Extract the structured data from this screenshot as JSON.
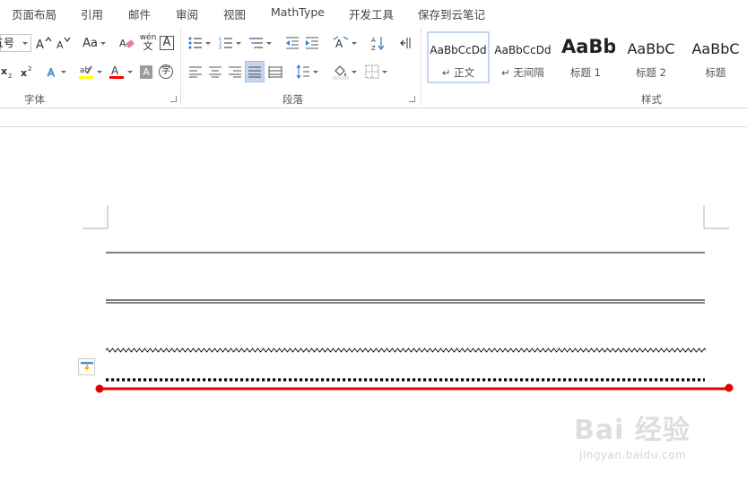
{
  "menu": {
    "tabs": [
      "页面布局",
      "引用",
      "邮件",
      "审阅",
      "视图",
      "MathType",
      "开发工具",
      "保存到云笔记"
    ]
  },
  "ribbon": {
    "font_size_value": "五号",
    "font_group_label": "字体",
    "paragraph_group_label": "段落",
    "styles_group_label": "样式",
    "change_case_label": "Aa",
    "phonetic_label_top": "wén",
    "phonetic_label_bottom": "文",
    "char_border_label": "A",
    "highlight_color": "#ffff00",
    "font_color": "#ff0000",
    "shading_label": "A",
    "enclose_label": "字"
  },
  "styles": [
    {
      "sample": "AaBbCcDd",
      "name": "↵ 正文",
      "active": true
    },
    {
      "sample": "AaBbCcDd",
      "name": "↵ 无间隔",
      "active": false
    },
    {
      "sample": "AaBb",
      "name": "标题 1",
      "active": false
    },
    {
      "sample": "AaBbC",
      "name": "标题 2",
      "active": false
    },
    {
      "sample": "AaBbC",
      "name": "标题",
      "active": false
    }
  ],
  "document": {
    "annotation_color": "#e00000"
  },
  "watermark": {
    "brand": "Bai 经验",
    "url": "jingyan.baidu.com"
  },
  "colors": {
    "accent": "#2b579a",
    "active_style_border": "#c5d7ef",
    "selected_button": "#c5d7ef"
  }
}
